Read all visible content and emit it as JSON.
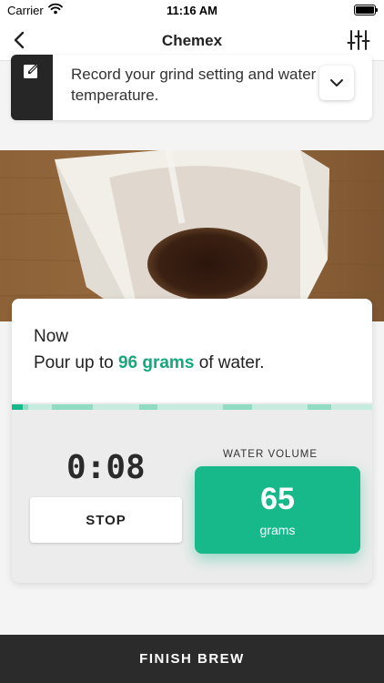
{
  "status_bar": {
    "carrier": "Carrier",
    "time": "11:16 AM"
  },
  "nav": {
    "title": "Chemex",
    "back_icon": "chevron-left-icon",
    "settings_icon": "sliders-icon"
  },
  "note": {
    "text": "Record your grind setting and water temperature.",
    "icon": "edit-icon",
    "expand_icon": "chevron-down-icon"
  },
  "step": {
    "label": "Now",
    "instruction_prefix": "Pour up to",
    "instruction_amount": "96 grams",
    "instruction_suffix": "of water."
  },
  "timer": {
    "value": "0:08"
  },
  "stop_button": {
    "label": "STOP"
  },
  "water_volume": {
    "label": "WATER VOLUME",
    "value": "65",
    "unit": "grams"
  },
  "finish_button": {
    "label": "FINISH BREW"
  },
  "colors": {
    "accent": "#17b88a",
    "accent_text": "#17a77e",
    "dark": "#2b2b2b"
  }
}
